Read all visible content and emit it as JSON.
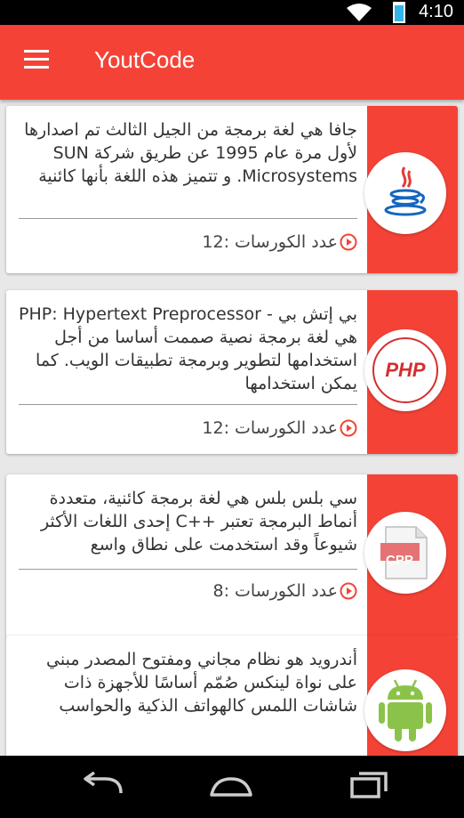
{
  "status": {
    "time": "4:10"
  },
  "appbar": {
    "title": "YoutCode"
  },
  "courses": [
    {
      "language": "Java",
      "description": "جافا هي لغة برمجة من الجيل الثالث تم اصدارها لأول مرة عام 1995 عن طريق شركة SUN Microsystems. و تتميز هذه اللغة بأنها كائنية",
      "count_label": "عدد الكورسات :12"
    },
    {
      "language": "PHP",
      "logo_text": "PHP",
      "description": "بي إتش بي - PHP: Hypertext Preprocessor هي لغة برمجة نصية صممت أساسا من أجل استخدامها لتطوير وبرمجة تطبيقات الويب. كما يمكن استخدامها",
      "count_label": "عدد الكورسات :12"
    },
    {
      "language": "C++",
      "logo_text": "CPP",
      "description": "سي بلس بلس هي لغة برمجة كائنية، متعددة أنماط البرمجة تعتبر ++C إحدى اللغات الأكثر شيوعاً وقد استخدمت على نطاق واسع",
      "count_label": "عدد الكورسات :8"
    },
    {
      "language": "Android",
      "description": "أندرويد هو نظام مجاني ومفتوح المصدر مبني على نواة لينكس صُمّم أساسًا للأجهزة ذات شاشات اللمس كالهواتف الذكية والحواسب",
      "count_label": ""
    }
  ],
  "colors": {
    "primary": "#f44336",
    "card_bg": "#ffffff",
    "page_bg": "#e8e8e8"
  }
}
